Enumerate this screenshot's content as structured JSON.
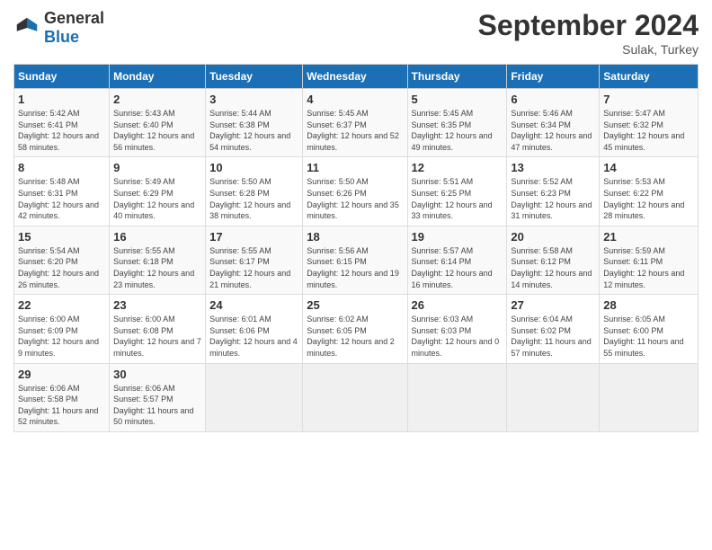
{
  "header": {
    "logo_general": "General",
    "logo_blue": "Blue",
    "month_title": "September 2024",
    "location": "Sulak, Turkey"
  },
  "weekdays": [
    "Sunday",
    "Monday",
    "Tuesday",
    "Wednesday",
    "Thursday",
    "Friday",
    "Saturday"
  ],
  "weeks": [
    [
      {
        "day": "1",
        "sunrise": "5:42 AM",
        "sunset": "6:41 PM",
        "daylight": "12 hours and 58 minutes."
      },
      {
        "day": "2",
        "sunrise": "5:43 AM",
        "sunset": "6:40 PM",
        "daylight": "12 hours and 56 minutes."
      },
      {
        "day": "3",
        "sunrise": "5:44 AM",
        "sunset": "6:38 PM",
        "daylight": "12 hours and 54 minutes."
      },
      {
        "day": "4",
        "sunrise": "5:45 AM",
        "sunset": "6:37 PM",
        "daylight": "12 hours and 52 minutes."
      },
      {
        "day": "5",
        "sunrise": "5:45 AM",
        "sunset": "6:35 PM",
        "daylight": "12 hours and 49 minutes."
      },
      {
        "day": "6",
        "sunrise": "5:46 AM",
        "sunset": "6:34 PM",
        "daylight": "12 hours and 47 minutes."
      },
      {
        "day": "7",
        "sunrise": "5:47 AM",
        "sunset": "6:32 PM",
        "daylight": "12 hours and 45 minutes."
      }
    ],
    [
      {
        "day": "8",
        "sunrise": "5:48 AM",
        "sunset": "6:31 PM",
        "daylight": "12 hours and 42 minutes."
      },
      {
        "day": "9",
        "sunrise": "5:49 AM",
        "sunset": "6:29 PM",
        "daylight": "12 hours and 40 minutes."
      },
      {
        "day": "10",
        "sunrise": "5:50 AM",
        "sunset": "6:28 PM",
        "daylight": "12 hours and 38 minutes."
      },
      {
        "day": "11",
        "sunrise": "5:50 AM",
        "sunset": "6:26 PM",
        "daylight": "12 hours and 35 minutes."
      },
      {
        "day": "12",
        "sunrise": "5:51 AM",
        "sunset": "6:25 PM",
        "daylight": "12 hours and 33 minutes."
      },
      {
        "day": "13",
        "sunrise": "5:52 AM",
        "sunset": "6:23 PM",
        "daylight": "12 hours and 31 minutes."
      },
      {
        "day": "14",
        "sunrise": "5:53 AM",
        "sunset": "6:22 PM",
        "daylight": "12 hours and 28 minutes."
      }
    ],
    [
      {
        "day": "15",
        "sunrise": "5:54 AM",
        "sunset": "6:20 PM",
        "daylight": "12 hours and 26 minutes."
      },
      {
        "day": "16",
        "sunrise": "5:55 AM",
        "sunset": "6:18 PM",
        "daylight": "12 hours and 23 minutes."
      },
      {
        "day": "17",
        "sunrise": "5:55 AM",
        "sunset": "6:17 PM",
        "daylight": "12 hours and 21 minutes."
      },
      {
        "day": "18",
        "sunrise": "5:56 AM",
        "sunset": "6:15 PM",
        "daylight": "12 hours and 19 minutes."
      },
      {
        "day": "19",
        "sunrise": "5:57 AM",
        "sunset": "6:14 PM",
        "daylight": "12 hours and 16 minutes."
      },
      {
        "day": "20",
        "sunrise": "5:58 AM",
        "sunset": "6:12 PM",
        "daylight": "12 hours and 14 minutes."
      },
      {
        "day": "21",
        "sunrise": "5:59 AM",
        "sunset": "6:11 PM",
        "daylight": "12 hours and 12 minutes."
      }
    ],
    [
      {
        "day": "22",
        "sunrise": "6:00 AM",
        "sunset": "6:09 PM",
        "daylight": "12 hours and 9 minutes."
      },
      {
        "day": "23",
        "sunrise": "6:00 AM",
        "sunset": "6:08 PM",
        "daylight": "12 hours and 7 minutes."
      },
      {
        "day": "24",
        "sunrise": "6:01 AM",
        "sunset": "6:06 PM",
        "daylight": "12 hours and 4 minutes."
      },
      {
        "day": "25",
        "sunrise": "6:02 AM",
        "sunset": "6:05 PM",
        "daylight": "12 hours and 2 minutes."
      },
      {
        "day": "26",
        "sunrise": "6:03 AM",
        "sunset": "6:03 PM",
        "daylight": "12 hours and 0 minutes."
      },
      {
        "day": "27",
        "sunrise": "6:04 AM",
        "sunset": "6:02 PM",
        "daylight": "11 hours and 57 minutes."
      },
      {
        "day": "28",
        "sunrise": "6:05 AM",
        "sunset": "6:00 PM",
        "daylight": "11 hours and 55 minutes."
      }
    ],
    [
      {
        "day": "29",
        "sunrise": "6:06 AM",
        "sunset": "5:58 PM",
        "daylight": "11 hours and 52 minutes."
      },
      {
        "day": "30",
        "sunrise": "6:06 AM",
        "sunset": "5:57 PM",
        "daylight": "11 hours and 50 minutes."
      },
      null,
      null,
      null,
      null,
      null
    ]
  ]
}
